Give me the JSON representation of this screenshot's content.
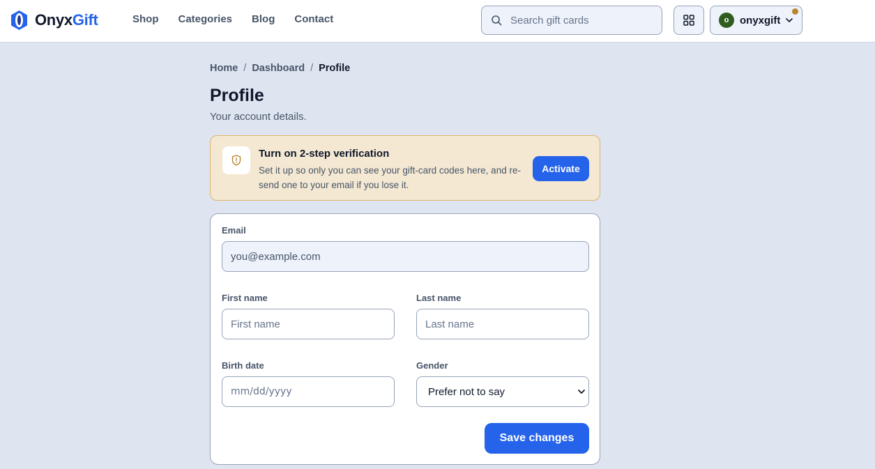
{
  "brand": {
    "name_part1": "Onyx",
    "name_part2": "Gift",
    "accent": "#2563eb"
  },
  "nav": {
    "items": [
      "Shop",
      "Categories",
      "Blog",
      "Contact"
    ]
  },
  "search": {
    "placeholder": "Search gift cards",
    "value": ""
  },
  "user": {
    "initial": "o",
    "name": "onyxgift",
    "avatar_color": "#2f5d1f",
    "notification_dot_color": "#b8862c"
  },
  "breadcrumb": {
    "items": [
      "Home",
      "Dashboard"
    ],
    "current": "Profile",
    "separator": "/"
  },
  "page": {
    "title": "Profile",
    "subtitle": "Your account details."
  },
  "banner": {
    "title": "Turn on 2-step verification",
    "body": "Set it up so only you can see your gift-card codes here, and re-send one to your email if you lose it.",
    "button_label": "Activate",
    "background_color": "#f4e8d2",
    "icon": "shield-icon"
  },
  "form": {
    "email": {
      "label": "Email",
      "placeholder": "you@example.com",
      "value": ""
    },
    "first_name": {
      "label": "First name",
      "placeholder": "First name",
      "value": ""
    },
    "last_name": {
      "label": "Last name",
      "placeholder": "Last name",
      "value": ""
    },
    "birth_date": {
      "label": "Birth date",
      "placeholder": "mm/dd/yyyy"
    },
    "gender": {
      "label": "Gender",
      "selected": "Prefer not to say"
    },
    "save_label": "Save changes"
  }
}
